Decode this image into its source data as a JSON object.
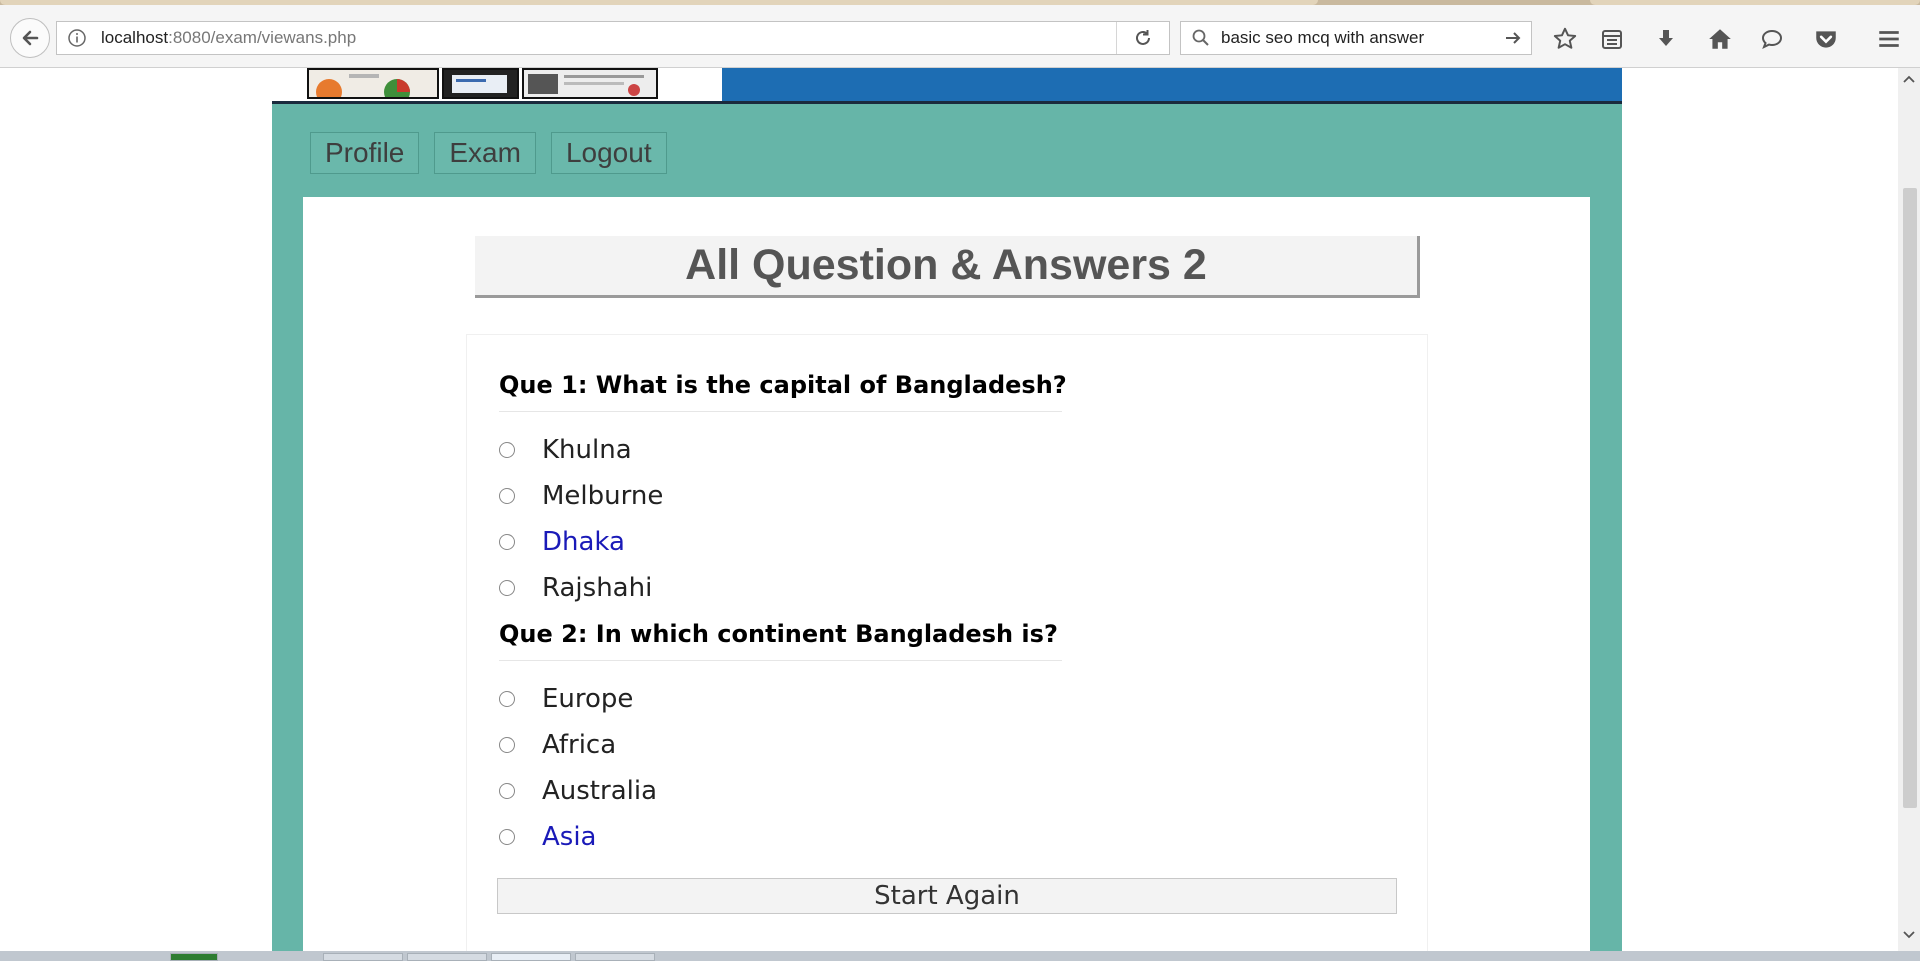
{
  "browser": {
    "url_host": "localhost",
    "url_rest": ":8080/exam/viewans.php",
    "search_query": "basic seo mcq with answer"
  },
  "nav": {
    "profile": "Profile",
    "exam": "Exam",
    "logout": "Logout"
  },
  "page_title": "All Question & Answers 2",
  "questions": [
    {
      "text": "Que 1: What is the capital of Bangladesh?",
      "options": [
        "Khulna",
        "Melburne",
        "Dhaka",
        "Rajshahi"
      ],
      "correct_option": "Dhaka"
    },
    {
      "text": "Que 2: In which continent Bangladesh is?",
      "options": [
        "Europe",
        "Africa",
        "Australia",
        "Asia"
      ],
      "correct_option": "Asia"
    }
  ],
  "start_again_label": "Start Again",
  "colors": {
    "wrapper_bg": "#66b5a8",
    "correct_answer": "#1a1ab8",
    "banner": "#1d6db3"
  }
}
